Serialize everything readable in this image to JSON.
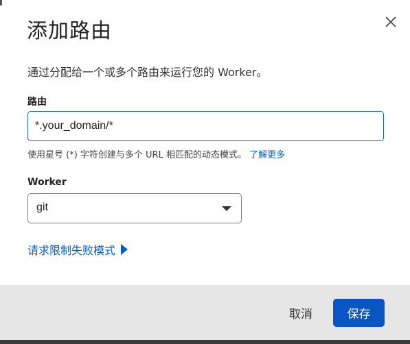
{
  "dialog": {
    "title": "添加路由",
    "description": "通过分配给一个或多个路由来运行您的 Worker。",
    "route_label": "路由",
    "route_value": "*.your_domain/*",
    "help_text": "使用星号 (*) 字符创建与多个 URL 相匹配的动态模式。",
    "help_link": "了解更多",
    "worker_label": "Worker",
    "worker_selected": "git",
    "fail_mode_link": "请求限制失败模式"
  },
  "footer": {
    "cancel_label": "取消",
    "save_label": "保存"
  },
  "colors": {
    "accent": "#0a55c4",
    "link": "#0a5fc4",
    "footer_bg": "#e6e6e6"
  },
  "icons": {
    "close": "close-icon",
    "dropdown": "chevron-down-icon",
    "expand": "triangle-right-icon"
  }
}
